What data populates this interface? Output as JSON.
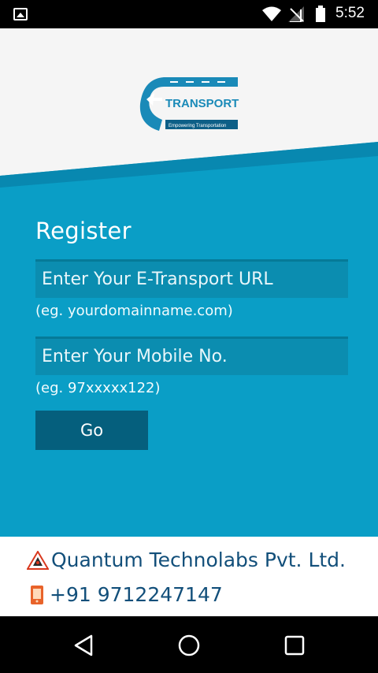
{
  "status_bar": {
    "time": "5:52",
    "icons": [
      "image-icon",
      "wifi-icon",
      "no-signal-icon",
      "battery-icon"
    ]
  },
  "logo": {
    "brand": "TRANSPORT",
    "tagline": "Empowering Transportation",
    "brand_color": "#1a8ab8"
  },
  "form": {
    "title": "Register",
    "url_placeholder": "Enter Your E-Transport URL",
    "url_hint": "(eg. yourdomainname.com)",
    "mobile_placeholder": "Enter Your Mobile No.",
    "mobile_hint": "(eg. 97xxxxx122)",
    "go_label": "Go"
  },
  "footer": {
    "company": "Quantum Technolabs Pvt. Ltd.",
    "phone": "+91 9712247147"
  },
  "colors": {
    "panel_blue": "#0a9ec6",
    "field_blue": "#0b8db0",
    "button_blue": "#055f7d",
    "footer_text": "#124f7a"
  },
  "nav_bar": {
    "icons": [
      "back-icon",
      "home-icon",
      "recent-apps-icon"
    ]
  }
}
